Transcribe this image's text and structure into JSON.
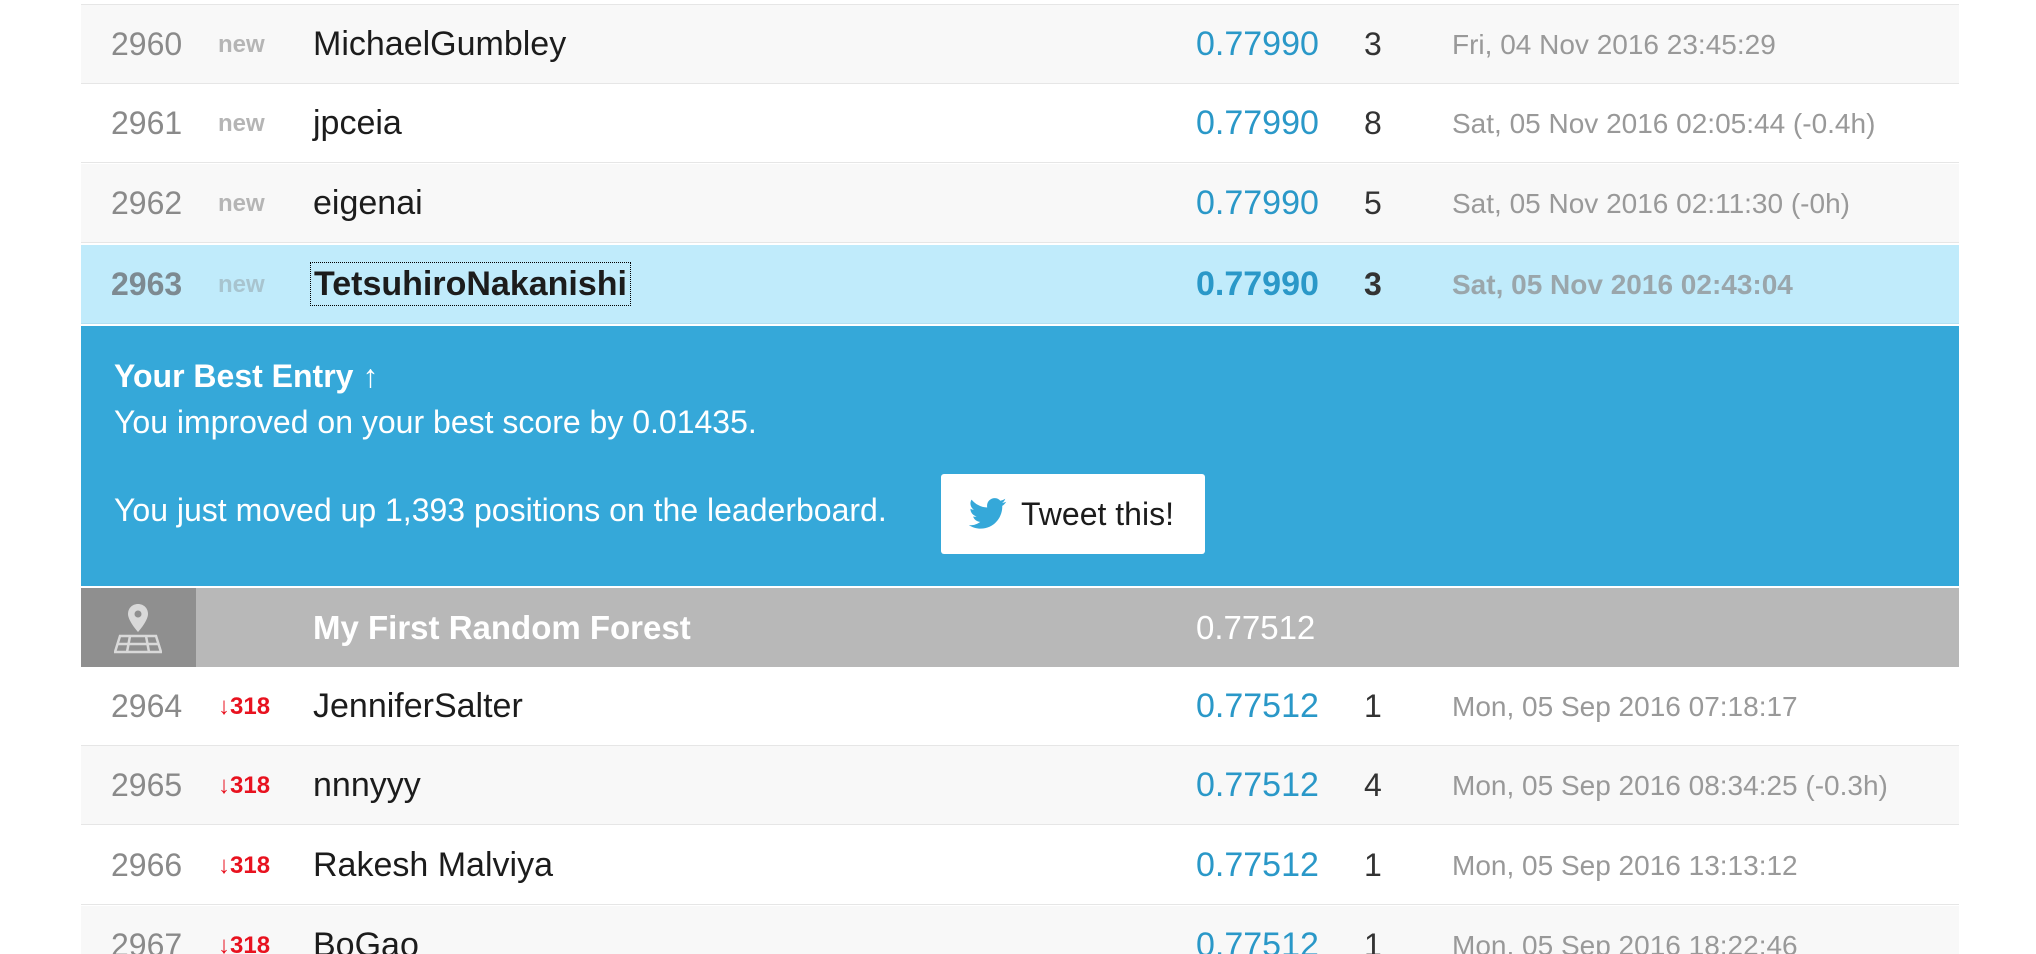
{
  "leaderboard": {
    "rows_above": [
      {
        "rank": "2960",
        "delta": "new",
        "team": "MichaelGumbley",
        "score": "0.77990",
        "entries": "3",
        "last": "Fri, 04 Nov 2016 23:45:29"
      },
      {
        "rank": "2961",
        "delta": "new",
        "team": "jpceia",
        "score": "0.77990",
        "entries": "8",
        "last": "Sat, 05 Nov 2016 02:05:44 (-0.4h)"
      },
      {
        "rank": "2962",
        "delta": "new",
        "team": "eigenai",
        "score": "0.77990",
        "entries": "5",
        "last": "Sat, 05 Nov 2016 02:11:30 (-0h)"
      }
    ],
    "my_row": {
      "rank": "2963",
      "delta": "new",
      "team": "TetsuhiroNakanishi",
      "score": "0.77990",
      "entries": "3",
      "last": "Sat, 05 Nov 2016 02:43:04"
    },
    "banner": {
      "title": "Your Best Entry ↑",
      "improved": "You improved on your best score by 0.01435.",
      "moved": "You just moved up 1,393 positions on the leaderboard.",
      "tweet_label": "Tweet this!",
      "tweet_icon": "twitter-bird-icon"
    },
    "benchmark": {
      "icon": "map-pin-icon",
      "name": "My First Random Forest",
      "score": "0.77512"
    },
    "rows_below": [
      {
        "rank": "2964",
        "delta": "↓318",
        "team": "JenniferSalter",
        "score": "0.77512",
        "entries": "1",
        "last": "Mon, 05 Sep 2016 07:18:17"
      },
      {
        "rank": "2965",
        "delta": "↓318",
        "team": "nnnyyy",
        "score": "0.77512",
        "entries": "4",
        "last": "Mon, 05 Sep 2016 08:34:25 (-0.3h)"
      },
      {
        "rank": "2966",
        "delta": "↓318",
        "team": "Rakesh Malviya",
        "score": "0.77512",
        "entries": "1",
        "last": "Mon, 05 Sep 2016 13:13:12"
      },
      {
        "rank": "2967",
        "delta": "↓318",
        "team": "BoGao",
        "score": "0.77512",
        "entries": "1",
        "last": "Mon, 05 Sep 2016 18:22:46"
      }
    ]
  },
  "colors": {
    "score": "#2a98c8",
    "my_row_bg": "#c0ebfb",
    "banner_bg": "#35a8d9",
    "benchmark_bg": "#b8b8b8",
    "rank_down": "#e8121f"
  }
}
